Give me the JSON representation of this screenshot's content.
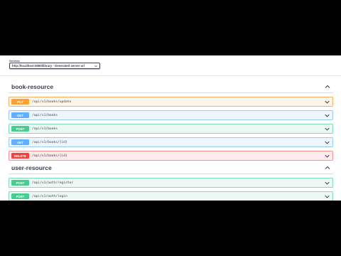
{
  "servers": {
    "label": "Servers",
    "selected": "http://localhost:8080/library - Generated server url"
  },
  "sections": [
    {
      "title": "book-resource",
      "operations": [
        {
          "method": "PUT",
          "path": "/api/v1/books/update"
        },
        {
          "method": "GET",
          "path": "/api/v1/books"
        },
        {
          "method": "POST",
          "path": "/api/v1/books"
        },
        {
          "method": "GET",
          "path": "/api/v1/books/{id}"
        },
        {
          "method": "DELETE",
          "path": "/api/v1/books/{id}"
        }
      ]
    },
    {
      "title": "user-resource",
      "operations": [
        {
          "method": "POST",
          "path": "/api/v1/auth/register"
        },
        {
          "method": "POST",
          "path": "/api/v1/auth/login"
        }
      ]
    }
  ],
  "colors": {
    "put": "#fca130",
    "get": "#61affe",
    "post": "#49cc90",
    "delete": "#f93e3e",
    "text": "#3b4151"
  },
  "icons": {
    "section_toggle": "chevron-up-icon",
    "operation_toggle": "chevron-down-icon",
    "select_caret": "caret-down-icon"
  }
}
